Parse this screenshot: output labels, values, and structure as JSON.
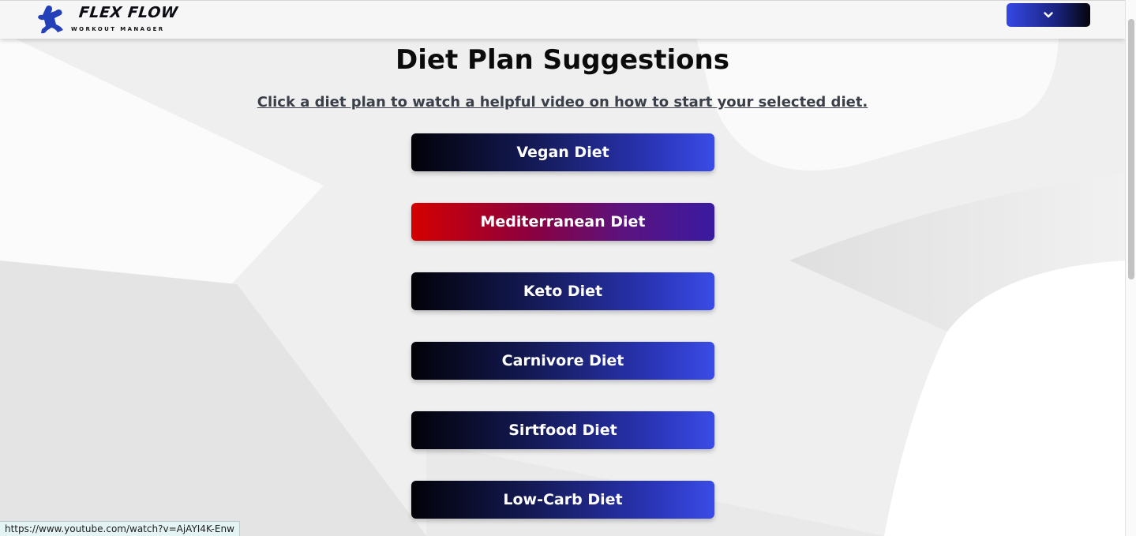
{
  "header": {
    "brand_title": "FLEX FLOW",
    "brand_subtitle": "WORKOUT MANAGER",
    "logo_icon": "bodybuilder-icon",
    "menu_icon": "chevron-down-icon"
  },
  "main": {
    "title": "Diet Plan Suggestions",
    "subtitle": "Click a diet plan to watch a helpful video on how to start your selected diet.",
    "diets": [
      {
        "label": "Vegan Diet"
      },
      {
        "label": "Mediterranean Diet"
      },
      {
        "label": "Keto Diet"
      },
      {
        "label": "Carnivore Diet"
      },
      {
        "label": "Sirtfood Diet"
      },
      {
        "label": "Low-Carb Diet"
      }
    ]
  },
  "status_bar": {
    "url": "https://www.youtube.com/watch?v=AjAYI4K-Enw"
  },
  "colors": {
    "button_gradient_start": "#020208",
    "button_gradient_end": "#3a4ce6",
    "hover_gradient_start": "#d40000",
    "hover_gradient_end": "#3a1aa0",
    "logo_blue": "#2340b8"
  }
}
